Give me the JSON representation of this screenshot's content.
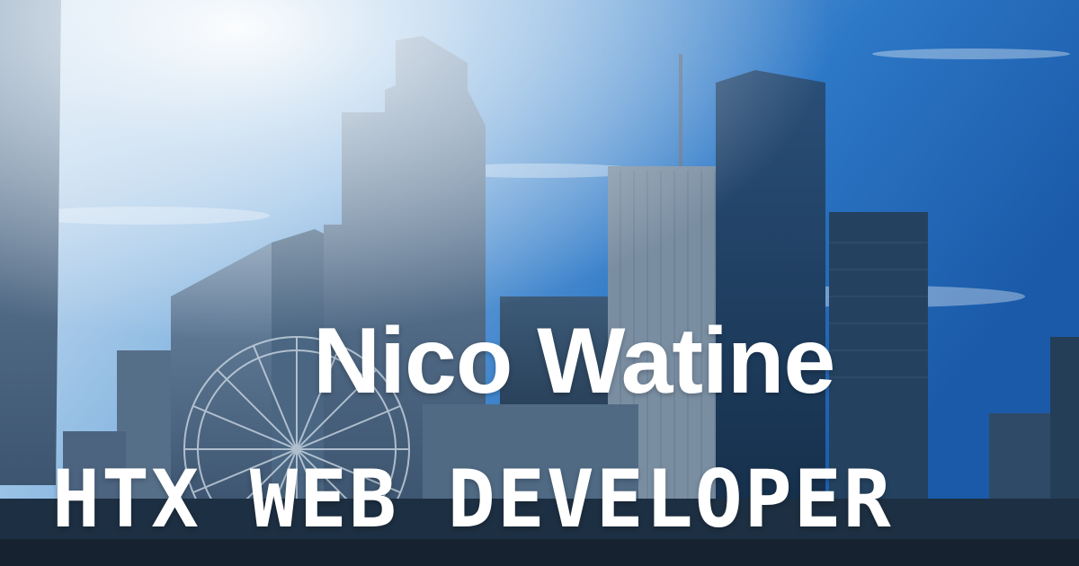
{
  "hero": {
    "name": "Nico Watine",
    "tagline": "HTX WEB DEVELOPER"
  },
  "colors": {
    "sky_top": "#1f64b4",
    "sky_glare": "#f4f8fc",
    "building_dark": "#1a2f45",
    "text": "#ffffff"
  }
}
